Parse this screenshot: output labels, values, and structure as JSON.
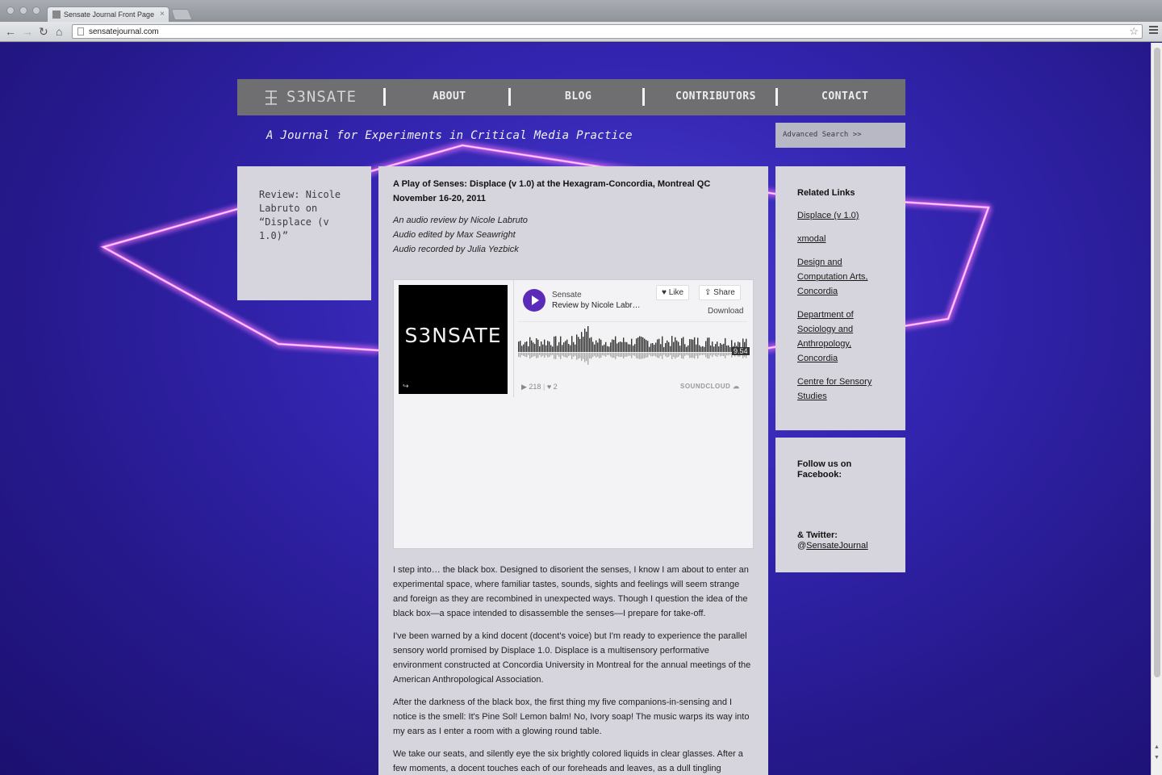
{
  "browser": {
    "tab_title": "Sensate Journal Front Page",
    "url": "sensatejournal.com"
  },
  "site": {
    "logo_text": "S3NSATE",
    "nav": [
      "ABOUT",
      "BLOG",
      "CONTRIBUTORS",
      "CONTACT"
    ],
    "tagline": "A Journal for Experiments in Critical Media Practice",
    "search_label": "Advanced Search >>"
  },
  "left_panel": {
    "text": "Review: Nicole Labruto on “Displace (v 1.0)”"
  },
  "article": {
    "title_line1": "A Play of Senses: Displace (v 1.0) at the Hexagram-Concordia, Montreal QC",
    "title_line2": "November 16-20, 2011",
    "credits": [
      "An audio review by Nicole Labruto",
      "Audio edited by Max Seawright",
      "Audio recorded by Julia Yezbick"
    ],
    "paragraphs": [
      "I step into… the black box. Designed to disorient the senses, I know I am about to enter an experimental space, where familiar tastes, sounds, sights and feelings will seem strange and foreign as they are recombined in unexpected ways. Though I question the idea of the black box—a space intended to disassemble the senses—I prepare for take-off.",
      "I've been warned by a kind docent (docent's voice) but I'm ready to experience the parallel sensory world promised by Displace 1.0. Displace is a multisensory performative environment constructed at Concordia University in Montreal for the annual meetings of the American Anthropological Association.",
      "After the darkness of the black box, the first thing my five companions-in-sensing and I notice is the smell: It's Pine Sol! Lemon balm! No, Ivory soap! The music warps its way into my ears as I enter a room with a glowing round table.",
      "We take our seats, and silently eye the six brightly colored liquids in clear glasses. After a few moments, a docent touches each of our foreheads and leaves, as a dull tingling"
    ]
  },
  "soundcloud": {
    "art_text": "S3NSATE",
    "art_corner": "↪",
    "user": "Sensate",
    "track": "Review by Nicole Labr…",
    "like_label": "♥ Like",
    "share_label": "⇪ Share",
    "download_label": "Download",
    "duration": "9.54",
    "plays": "▶ 218",
    "likes": "♥ 2",
    "brand": "SOUNDCLOUD"
  },
  "related": {
    "title": "Related Links",
    "links": [
      "Displace (v 1.0)",
      "xmodal",
      "Design and Computation Arts, Concordia",
      "Department of Sociology and Anthropology, Concordia",
      "Centre for Sensory Studies"
    ]
  },
  "follow": {
    "facebook_label": "Follow us on Facebook:",
    "twitter_label": "& Twitter:",
    "twitter_at": "@",
    "twitter_handle": "SensateJournal"
  },
  "colors": {
    "accent_purple": "#5b2ab8",
    "nav_bg": "#6f6f72",
    "panel_bg": "#d6d4dc",
    "background": "#3325b0",
    "glow": "#ff6bff"
  }
}
